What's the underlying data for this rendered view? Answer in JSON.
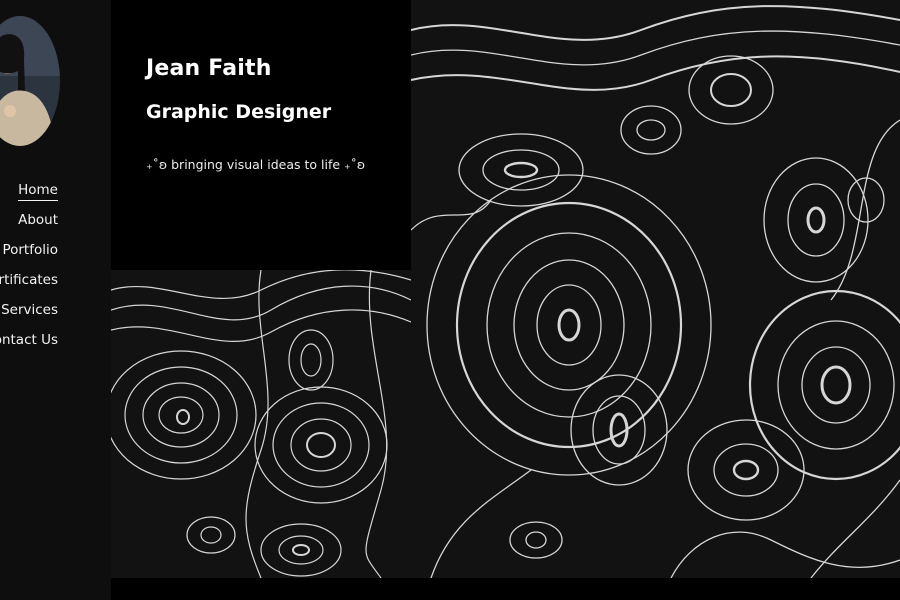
{
  "profile": {
    "name": "Jean Faith",
    "role": "Graphic Designer",
    "tagline": "₊˚ʚ bringing visual ideas to life ₊˚ʚ"
  },
  "nav": {
    "items": [
      {
        "label": "Home",
        "active": true
      },
      {
        "label": "About"
      },
      {
        "label": "Portfolio"
      },
      {
        "label": "Certificates"
      },
      {
        "label": "Services"
      },
      {
        "label": "Contact Us"
      }
    ]
  },
  "theme": {
    "background": "#0d0d0d",
    "panel": "#000000",
    "contour_stroke": "#d6d6d6"
  },
  "icons": {
    "avatar": "profile-photo",
    "pattern": "topographic-contour-lines"
  }
}
